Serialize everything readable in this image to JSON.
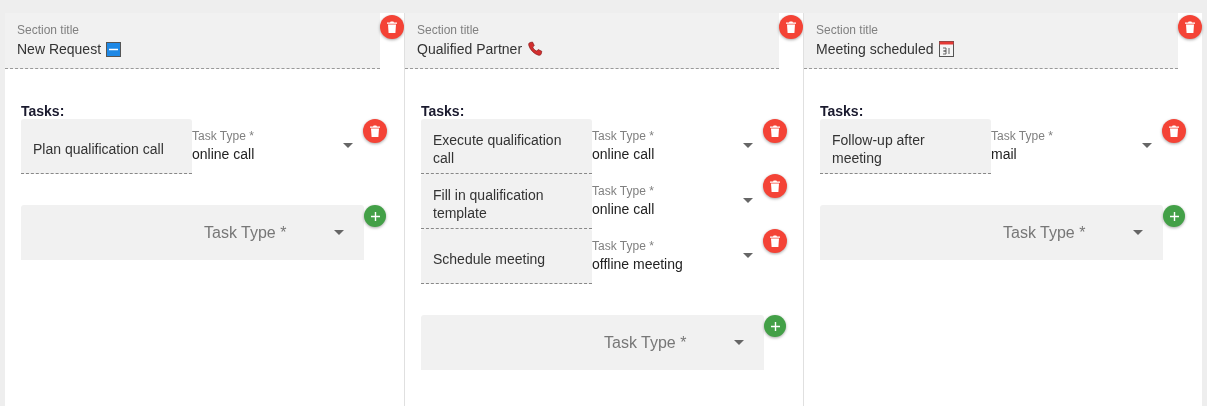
{
  "sections": [
    {
      "title_label": "Section title",
      "title": "New Request",
      "title_icon": {
        "kind": "new"
      },
      "tasks_label": "Tasks:",
      "tasks": [
        {
          "name": "Plan qualification call",
          "type_label": "Task Type *",
          "type": "online call"
        }
      ],
      "new_task": {
        "type_placeholder": "Task Type *"
      }
    },
    {
      "title_label": "Section title",
      "title": "Qualified Partner",
      "title_icon": {
        "kind": "phone"
      },
      "tasks_label": "Tasks:",
      "tasks": [
        {
          "name": "Execute qualification call",
          "type_label": "Task Type *",
          "type": "online call"
        },
        {
          "name": "Fill in qualification template",
          "type_label": "Task Type *",
          "type": "online call"
        },
        {
          "name": "Schedule meeting",
          "type_label": "Task Type *",
          "type": "offline meeting"
        }
      ],
      "new_task": {
        "type_placeholder": "Task Type *"
      }
    },
    {
      "title_label": "Section title",
      "title": "Meeting scheduled",
      "title_icon": {
        "kind": "calendar"
      },
      "tasks_label": "Tasks:",
      "tasks": [
        {
          "name": "Follow-up after meeting",
          "type_label": "Task Type *",
          "type": "mail"
        }
      ],
      "new_task": {
        "type_placeholder": "Task Type *"
      }
    }
  ]
}
